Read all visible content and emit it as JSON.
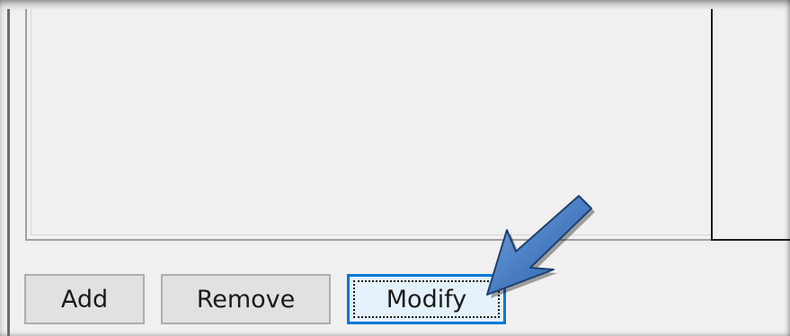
{
  "buttons": {
    "add_label": "Add",
    "remove_label": "Remove",
    "modify_label": "Modify"
  },
  "colors": {
    "focus_border": "#0078d7",
    "button_face": "#e1e1e1",
    "arrow_fill": "#4a7fc4"
  },
  "annotation": {
    "icon": "pointer-arrow-icon"
  }
}
